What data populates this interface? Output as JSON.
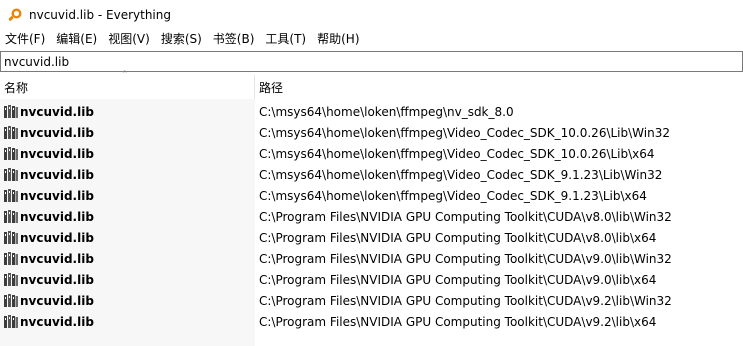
{
  "window": {
    "title": "nvcuvid.lib - Everything"
  },
  "menu": [
    {
      "label": "文件(F)"
    },
    {
      "label": "编辑(E)"
    },
    {
      "label": "视图(V)"
    },
    {
      "label": "搜索(S)"
    },
    {
      "label": "书签(B)"
    },
    {
      "label": "工具(T)"
    },
    {
      "label": "帮助(H)"
    }
  ],
  "search": {
    "value": "nvcuvid.lib"
  },
  "columns": {
    "name": "名称",
    "path": "路径"
  },
  "rows": [
    {
      "name": "nvcuvid.lib",
      "path": "C:\\msys64\\home\\loken\\ffmpeg\\nv_sdk_8.0"
    },
    {
      "name": "nvcuvid.lib",
      "path": "C:\\msys64\\home\\loken\\ffmpeg\\Video_Codec_SDK_10.0.26\\Lib\\Win32"
    },
    {
      "name": "nvcuvid.lib",
      "path": "C:\\msys64\\home\\loken\\ffmpeg\\Video_Codec_SDK_10.0.26\\Lib\\x64"
    },
    {
      "name": "nvcuvid.lib",
      "path": "C:\\msys64\\home\\loken\\ffmpeg\\Video_Codec_SDK_9.1.23\\Lib\\Win32"
    },
    {
      "name": "nvcuvid.lib",
      "path": "C:\\msys64\\home\\loken\\ffmpeg\\Video_Codec_SDK_9.1.23\\Lib\\x64"
    },
    {
      "name": "nvcuvid.lib",
      "path": "C:\\Program Files\\NVIDIA GPU Computing Toolkit\\CUDA\\v8.0\\lib\\Win32"
    },
    {
      "name": "nvcuvid.lib",
      "path": "C:\\Program Files\\NVIDIA GPU Computing Toolkit\\CUDA\\v8.0\\lib\\x64"
    },
    {
      "name": "nvcuvid.lib",
      "path": "C:\\Program Files\\NVIDIA GPU Computing Toolkit\\CUDA\\v9.0\\lib\\Win32"
    },
    {
      "name": "nvcuvid.lib",
      "path": "C:\\Program Files\\NVIDIA GPU Computing Toolkit\\CUDA\\v9.0\\lib\\x64"
    },
    {
      "name": "nvcuvid.lib",
      "path": "C:\\Program Files\\NVIDIA GPU Computing Toolkit\\CUDA\\v9.2\\lib\\Win32"
    },
    {
      "name": "nvcuvid.lib",
      "path": "C:\\Program Files\\NVIDIA GPU Computing Toolkit\\CUDA\\v9.2\\lib\\x64"
    }
  ],
  "icons": {
    "app": "everything-search-icon",
    "file": "library-file-icon",
    "sort": "sort-ascending-icon"
  },
  "colors": {
    "app_icon": "#e8840c",
    "lib_icon_dark": "#3c3c3c"
  }
}
